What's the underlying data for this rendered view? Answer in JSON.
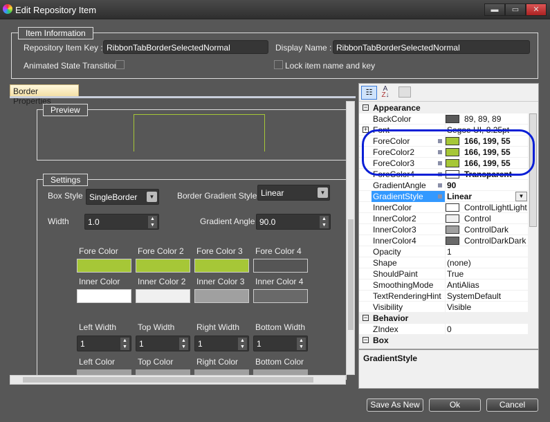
{
  "window": {
    "title": "Edit Repository Item",
    "minimize": "▬",
    "maximize": "▭",
    "close": "✕"
  },
  "item_info": {
    "legend": "Item Information",
    "key_label": "Repository Item Key :",
    "key_value": "RibbonTabBorderSelectedNormal",
    "display_label": "Display Name :",
    "display_value": "RibbonTabBorderSelectedNormal",
    "animated_label": "Animated State Transition",
    "lock_label": "Lock item name and key"
  },
  "tab": {
    "label": "Border Properties"
  },
  "preview": {
    "legend": "Preview"
  },
  "settings": {
    "legend": "Settings",
    "box_style_label": "Box Style",
    "box_style_value": "SingleBorder",
    "gradient_style_label": "Border Gradient Style",
    "gradient_style_value": "Linear",
    "width_label": "Width",
    "width_value": "1.0",
    "gradient_angle_label": "Gradient Angle",
    "gradient_angle_value": "90.0",
    "fore_colors": [
      {
        "label": "Fore Color",
        "color": "#a6c737"
      },
      {
        "label": "Fore Color 2",
        "color": "#a6c737"
      },
      {
        "label": "Fore Color 3",
        "color": "#a6c737"
      },
      {
        "label": "Fore Color 4",
        "color": "transparent"
      }
    ],
    "inner_colors": [
      {
        "label": "Inner Color",
        "color": "#ffffff"
      },
      {
        "label": "Inner Color 2",
        "color": "#f0f0f0"
      },
      {
        "label": "Inner Color 3",
        "color": "#a0a0a0"
      },
      {
        "label": "Inner Color 4",
        "color": "#696969"
      }
    ],
    "widths": [
      {
        "label": "Left Width",
        "value": "1"
      },
      {
        "label": "Top Width",
        "value": "1"
      },
      {
        "label": "Right Width",
        "value": "1"
      },
      {
        "label": "Bottom Width",
        "value": "1"
      }
    ],
    "side_colors": [
      {
        "label": "Left Color"
      },
      {
        "label": "Top Color"
      },
      {
        "label": "Right Color"
      },
      {
        "label": "Bottom Color"
      }
    ]
  },
  "property_grid": {
    "rows": [
      {
        "type": "cat",
        "name": "Appearance",
        "box": "−"
      },
      {
        "name": "BackColor",
        "value": "89, 89, 89",
        "swatch": "#595959"
      },
      {
        "type": "cat2",
        "name": "Font",
        "value": "Segoe UI, 8.25pt",
        "box": "+"
      },
      {
        "name": "ForeColor",
        "value": "166, 199, 55",
        "swatch": "#a6c737",
        "bold": true,
        "marker": true
      },
      {
        "name": "ForeColor2",
        "value": "166, 199, 55",
        "swatch": "#a6c737",
        "bold": true,
        "marker": true
      },
      {
        "name": "ForeColor3",
        "value": "166, 199, 55",
        "swatch": "#a6c737",
        "bold": true,
        "marker": true
      },
      {
        "name": "ForeColor4",
        "value": "Transparent",
        "swatch": "#ffffff",
        "bold": true,
        "marker": true
      },
      {
        "name": "GradientAngle",
        "value": "90",
        "bold": true,
        "marker": true
      },
      {
        "name": "GradientStyle",
        "value": "Linear",
        "bold": true,
        "marker": true,
        "selected": true
      },
      {
        "name": "InnerColor",
        "value": "ControlLightLight",
        "swatch": "#ffffff"
      },
      {
        "name": "InnerColor2",
        "value": "Control",
        "swatch": "#f0f0f0"
      },
      {
        "name": "InnerColor3",
        "value": "ControlDark",
        "swatch": "#a0a0a0"
      },
      {
        "name": "InnerColor4",
        "value": "ControlDarkDark",
        "swatch": "#696969"
      },
      {
        "name": "Opacity",
        "value": "1"
      },
      {
        "name": "Shape",
        "value": "(none)"
      },
      {
        "name": "ShouldPaint",
        "value": "True"
      },
      {
        "name": "SmoothingMode",
        "value": "AntiAlias"
      },
      {
        "name": "TextRenderingHint",
        "value": "SystemDefault"
      },
      {
        "name": "Visibility",
        "value": "Visible"
      },
      {
        "type": "cat",
        "name": "Behavior",
        "box": "−"
      },
      {
        "name": "ZIndex",
        "value": "0"
      },
      {
        "type": "cat",
        "name": "Box",
        "box": "−"
      }
    ],
    "description_title": "GradientStyle",
    "highlight_color": "#0a1fd6"
  },
  "buttons": {
    "save_as_new": "Save As New",
    "ok": "Ok",
    "cancel": "Cancel"
  }
}
